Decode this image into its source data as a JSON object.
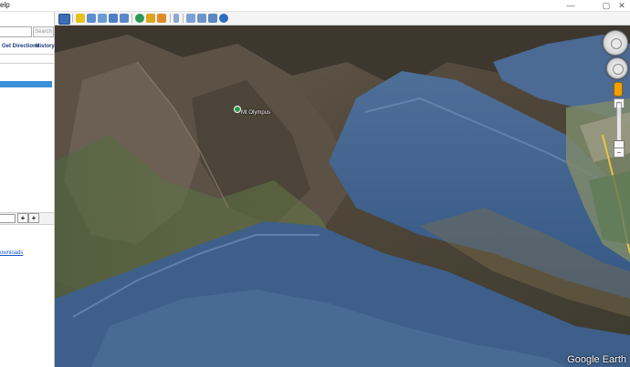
{
  "window": {
    "menu_fragment": "elp",
    "minimize_glyph": "—",
    "maximize_glyph": "▢",
    "close_glyph": "✕"
  },
  "sidebar": {
    "search_button_label": "Search",
    "links": [
      "Get Directions",
      "History"
    ],
    "layers_add_label": "+",
    "layers_add_label_2": "+",
    "downloads_link": "ownloads"
  },
  "toolbar": {
    "icons": [
      "sidebar-toggle-icon",
      "placemark-icon",
      "polygon-icon",
      "path-icon",
      "image-overlay-icon",
      "record-tour-icon",
      "historical-imagery-icon",
      "sunlight-icon",
      "planets-icon",
      "ruler-icon",
      "email-icon",
      "print-icon",
      "save-image-icon",
      "view-in-maps-icon"
    ]
  },
  "view": {
    "placemark_label": "Mt Olympus",
    "watermark": "Google Earth",
    "zoom_plus_label": "+",
    "zoom_minus_label": "−"
  },
  "colors": {
    "selected_row": "#3a8fd9",
    "link": "#1a3a7a",
    "pegman": "#f0a000"
  }
}
